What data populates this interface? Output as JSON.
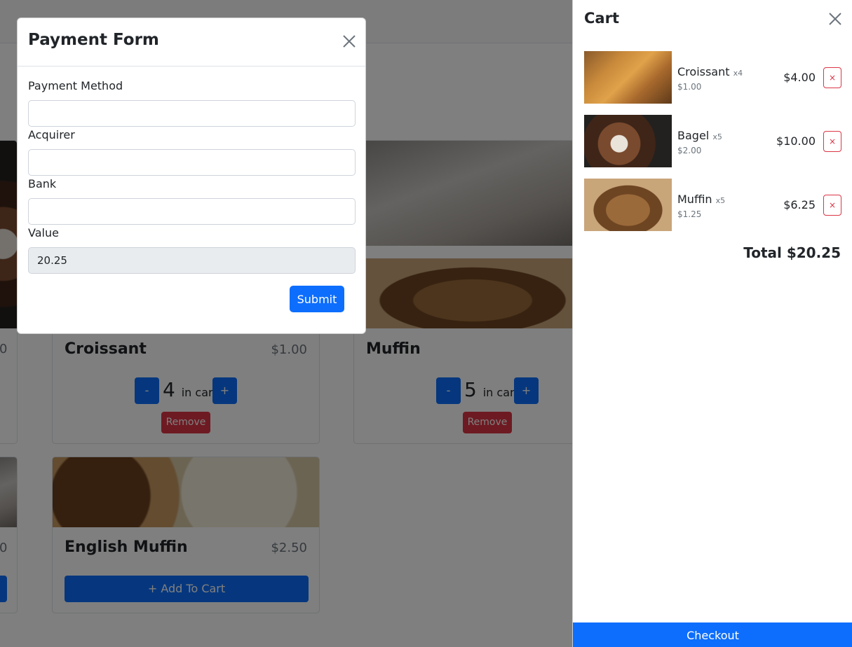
{
  "store": {
    "cards": [
      {
        "title": "Croissant",
        "price": "$1.00",
        "qty": "4",
        "qty_suffix": "in cart",
        "minus": "-",
        "plus": "+",
        "remove": "Remove"
      },
      {
        "title": "Muffin",
        "qty": "5",
        "qty_suffix": "in cart",
        "minus": "-",
        "plus": "+",
        "remove": "Remove"
      },
      {
        "title": "English Muffin",
        "price": "$2.50",
        "add": "+ Add To Cart"
      }
    ],
    "partial_price_1": "0",
    "partial_price_2": "0"
  },
  "modal": {
    "title": "Payment Form",
    "fields": [
      {
        "label": "Payment Method",
        "value": ""
      },
      {
        "label": "Acquirer",
        "value": ""
      },
      {
        "label": "Bank",
        "value": ""
      },
      {
        "label": "Value",
        "value": "20.25"
      }
    ],
    "submit_label": "Submit"
  },
  "cart": {
    "title": "Cart",
    "items": [
      {
        "name": "Croissant",
        "qty": "x4",
        "unit_price": "$1.00",
        "total": "$4.00",
        "remove": "×"
      },
      {
        "name": "Bagel",
        "qty": "x5",
        "unit_price": "$2.00",
        "total": "$10.00",
        "remove": "×"
      },
      {
        "name": "Muffin",
        "qty": "x5",
        "unit_price": "$1.25",
        "total": "$6.25",
        "remove": "×"
      }
    ],
    "total_label": "Total $20.25",
    "checkout_label": "Checkout"
  },
  "colors": {
    "primary": "#0d6efd",
    "danger": "#dc3545"
  },
  "icons": {
    "modal_close": "close-icon",
    "cart_close": "close-icon"
  }
}
